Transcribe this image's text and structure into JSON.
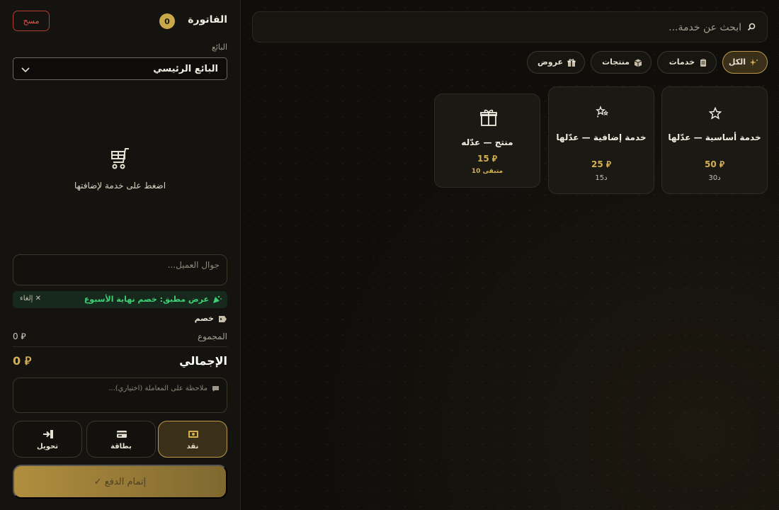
{
  "invoice": {
    "title": "الفاتورة",
    "item_count": "0",
    "clear_label": "مسح",
    "seller_label": "البائع",
    "seller_value": "البائع الرئيسي",
    "empty_message": "اضغط على خدمة لإضافتها",
    "customer_phone_placeholder": "جوال العميل...",
    "applied_offer": "عرض مطبق: خصم نهاية الأسبوع",
    "cancel_offer_label": "✕ إلغاء",
    "discount_label": "خصم",
    "subtotal_label": "المجموع",
    "subtotal_value": "0 ⃁",
    "total_label": "الإجمالي",
    "total_value": "0 ⃁",
    "note_placeholder": "ملاحظة على المعاملة (اختياري)...",
    "payment_methods": [
      {
        "label": "نقد",
        "icon": "cash-icon",
        "active": true
      },
      {
        "label": "بطاقة",
        "icon": "card-icon",
        "active": false
      },
      {
        "label": "تحويل",
        "icon": "transfer-icon",
        "active": false
      }
    ],
    "checkout_label": "إتمام الدفع ✓"
  },
  "catalog": {
    "search_placeholder": "ابحث عن خدمة...",
    "filters": [
      {
        "label": "الكل",
        "icon": "sparkle-icon",
        "active": true
      },
      {
        "label": "خدمات",
        "icon": "clipboard-icon",
        "active": false
      },
      {
        "label": "منتجات",
        "icon": "box-icon",
        "active": false
      },
      {
        "label": "عروض",
        "icon": "gift-icon",
        "active": false
      }
    ],
    "items": [
      {
        "name": "خدمة أساسية — عدّلها",
        "price": "50 ⃁",
        "sub": "30د",
        "icon": "star-icon"
      },
      {
        "name": "خدمة إضافية — عدّلها",
        "price": "25 ⃁",
        "sub": "15د",
        "icon": "sparkle-stars-icon"
      },
      {
        "name": "منتج — عدّله",
        "price": "15 ⃁",
        "stock": "متبقى 10",
        "icon": "gift-box-icon"
      }
    ]
  },
  "colors": {
    "accent_gold": "#d4b053",
    "offer_green": "#3fcf74",
    "danger_red": "#e3574d",
    "panel_bg": "#15130f"
  }
}
